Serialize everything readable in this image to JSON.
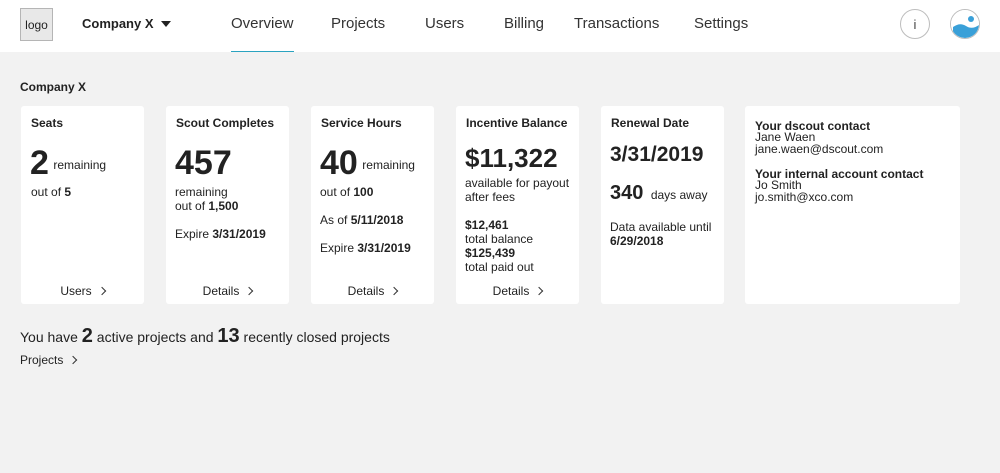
{
  "header": {
    "logo_text": "logo",
    "company": "Company X",
    "tabs": [
      "Overview",
      "Projects",
      "Users",
      "Billing",
      "Transactions",
      "Settings"
    ],
    "active_tab": "Overview",
    "info_label": "i",
    "accent_color": "#2aa3c0"
  },
  "page_title": "Company X",
  "cards": {
    "seats": {
      "title": "Seats",
      "count": "2",
      "count_label": "remaining",
      "out_of_label": "out of",
      "out_of_value": "5",
      "link": "Users"
    },
    "scout": {
      "title": "Scout Completes",
      "count": "457",
      "line1": "remaining",
      "out_of_label": "out of",
      "out_of_value": "1,500",
      "expire_label": "Expire",
      "expire_value": "3/31/2019",
      "link": "Details"
    },
    "service": {
      "title": "Service Hours",
      "count": "40",
      "count_label": "remaining",
      "out_of_label": "out of",
      "out_of_value": "100",
      "asof_label": "As of",
      "asof_value": "5/11/2018",
      "expire_label": "Expire",
      "expire_value": "3/31/2019",
      "link": "Details"
    },
    "incentive": {
      "title": "Incentive Balance",
      "amount": "$11,322",
      "line1": "available for payout",
      "line2": "after fees",
      "total_balance": "$12,461",
      "total_balance_label": "total balance",
      "total_paid": "$125,439",
      "total_paid_label": "total paid out",
      "link": "Details"
    },
    "renewal": {
      "title": "Renewal Date",
      "date": "3/31/2019",
      "days": "340",
      "days_label": "days away",
      "data_label": "Data available until",
      "data_value": "6/29/2018"
    },
    "contacts": {
      "dscout_title": "Your dscout contact",
      "dscout_name": "Jane Waen",
      "dscout_email": "jane.waen@dscout.com",
      "internal_title": "Your internal account contact",
      "internal_name": "Jo Smith",
      "internal_email": "jo.smith@xco.com"
    }
  },
  "summary": {
    "prefix": "You have",
    "active_count": "2",
    "middle": "active projects and",
    "closed_count": "13",
    "suffix": "recently closed projects",
    "link": "Projects"
  }
}
